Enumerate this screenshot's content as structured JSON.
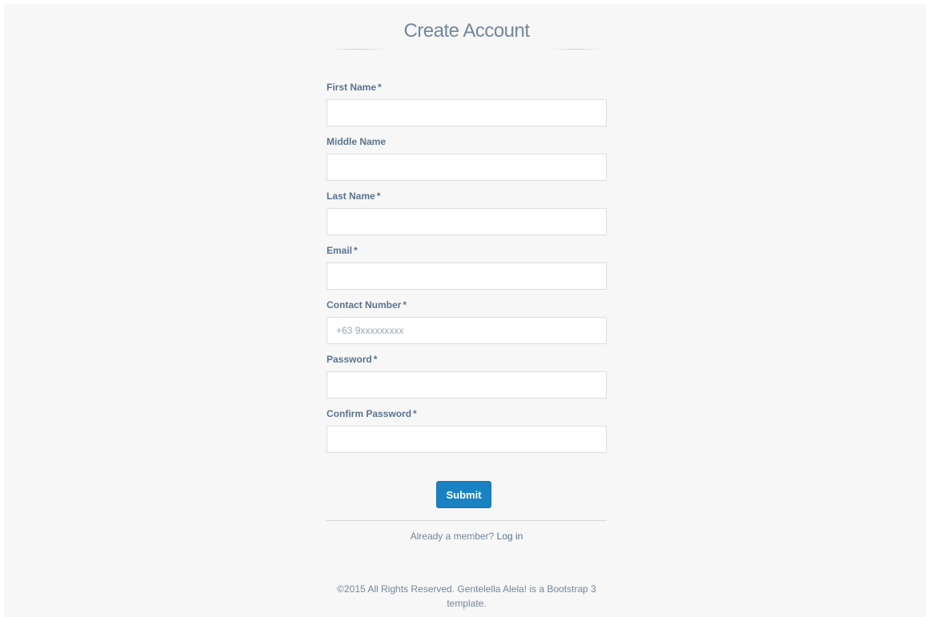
{
  "header": {
    "title": "Create Account"
  },
  "form": {
    "first_name": {
      "label": "First Name",
      "required_mark": "*",
      "value": "",
      "placeholder": ""
    },
    "middle_name": {
      "label": "Middle Name",
      "value": "",
      "placeholder": ""
    },
    "last_name": {
      "label": "Last Name",
      "required_mark": "*",
      "value": "",
      "placeholder": ""
    },
    "email": {
      "label": "Email",
      "required_mark": "*",
      "value": "",
      "placeholder": ""
    },
    "contact_number": {
      "label": "Contact Number",
      "required_mark": "*",
      "value": "",
      "placeholder": "+63 9xxxxxxxxx"
    },
    "password": {
      "label": "Password",
      "required_mark": "*",
      "value": "",
      "placeholder": ""
    },
    "confirm_password": {
      "label": "Confirm Password",
      "required_mark": "*",
      "value": "",
      "placeholder": ""
    },
    "submit_label": "Submit"
  },
  "member": {
    "prompt": "Already a member?",
    "login_link": "Log in"
  },
  "footer": {
    "text": "©2015 All Rights Reserved. Gentelella Alela! is a Bootstrap 3 template."
  },
  "colors": {
    "page_background": "#f7f7f7",
    "text": "#73879c",
    "label": "#5a738e",
    "primary_button": "#1a82c3",
    "input_border": "#dddee0"
  }
}
